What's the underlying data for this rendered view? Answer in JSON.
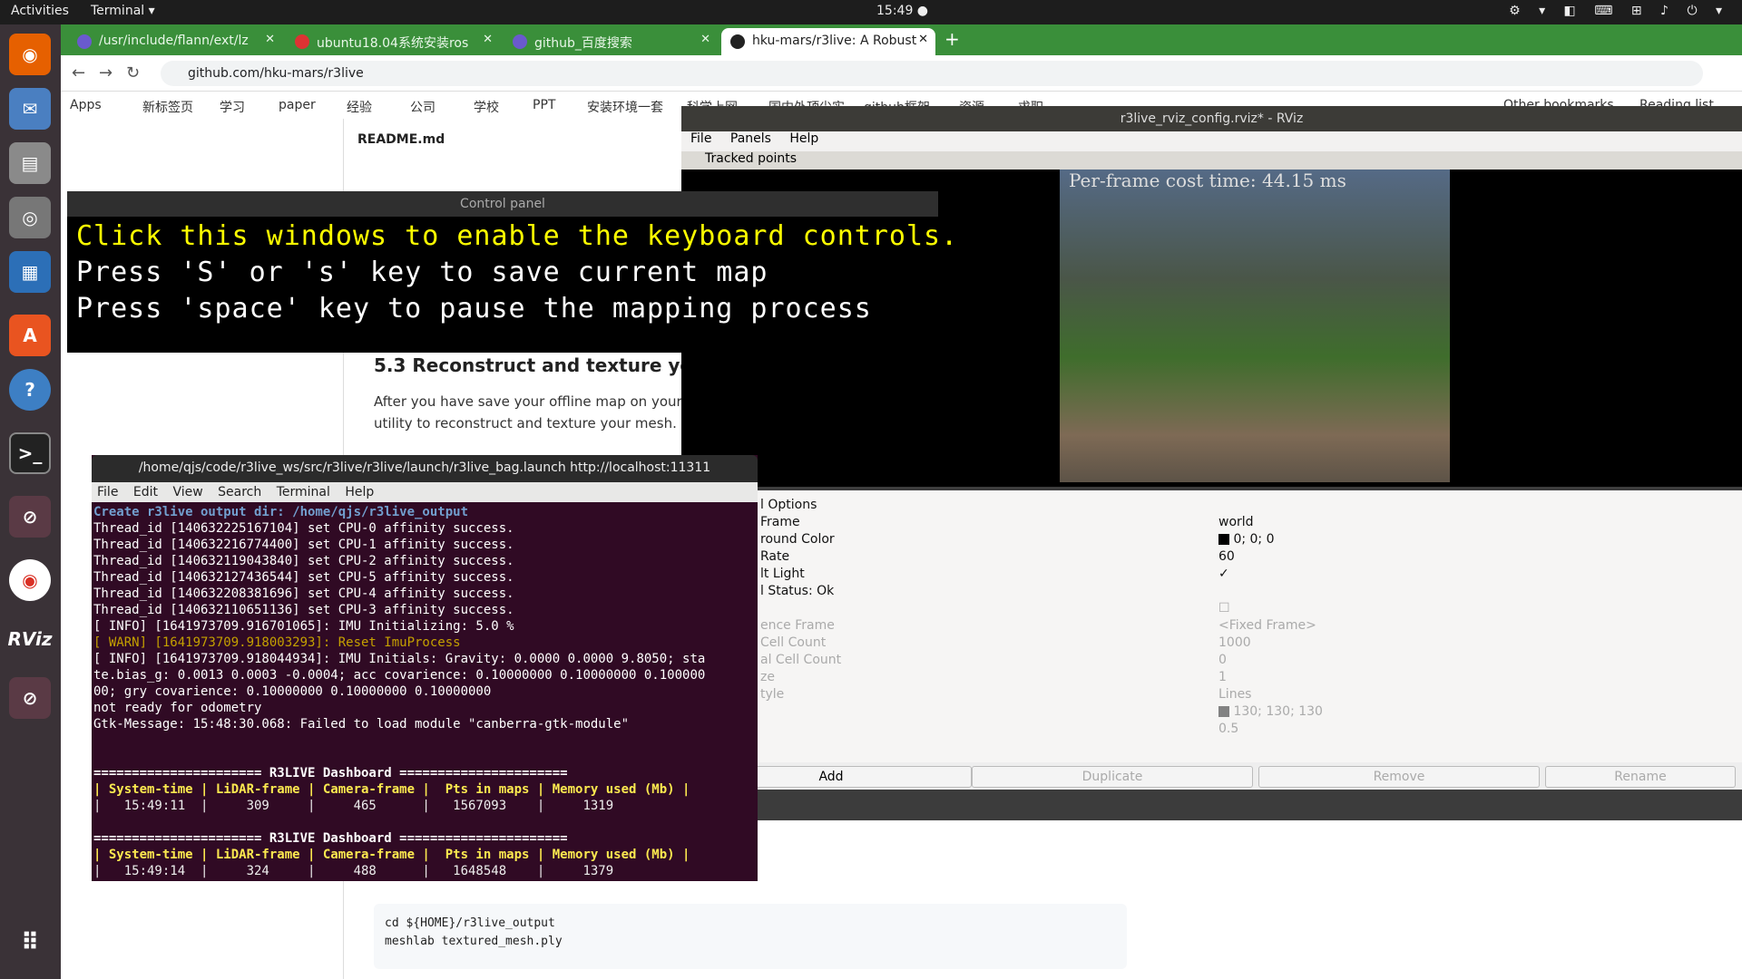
{
  "topbar": {
    "activities": "Activities",
    "app": "Terminal ▾",
    "clock": "15:49 ●"
  },
  "tabs": [
    {
      "title": "/usr/include/flann/ext/lz"
    },
    {
      "title": "ubuntu18.04系统安装ros"
    },
    {
      "title": "github_百度搜索"
    },
    {
      "title": "hku-mars/r3live: A Robust"
    }
  ],
  "url": "github.com/hku-mars/r3live",
  "bookmarks": [
    "Apps",
    "新标签页",
    "学习",
    "paper",
    "经验",
    "公司",
    "学校",
    "PPT",
    "安装环境一套",
    "科学上网",
    "国内外顶尖实",
    "github框架",
    "资源",
    "求职",
    "Other bookmarks",
    "Reading list"
  ],
  "page": {
    "readme": "README.md",
    "heading": "5.3 Reconstruct and texture your me",
    "para": "After you have save your offline map on your dis our utility to reconstruct and texture your mesh.",
    "code_lines": [
      "cd ${HOME}/r3live_output",
      "meshlab textured_mesh.ply"
    ]
  },
  "rviz": {
    "title": "r3live_rviz_config.rviz* - RViz",
    "menu": [
      "File",
      "Panels",
      "Help"
    ],
    "tracked": "Tracked points",
    "overlay": "Per-frame cost time: 44.15 ms",
    "props": [
      {
        "label": "l Options",
        "value": ""
      },
      {
        "label": "Frame",
        "value": "world"
      },
      {
        "label": "round Color",
        "value": "0; 0; 0"
      },
      {
        "label": "Rate",
        "value": "60"
      },
      {
        "label": "lt Light",
        "value": "✓"
      },
      {
        "label": "l Status: Ok",
        "value": ""
      },
      {
        "label": "",
        "value": "☐"
      },
      {
        "label": "ence Frame",
        "value": "<Fixed Frame>"
      },
      {
        "label": "Cell Count",
        "value": "1000"
      },
      {
        "label": "al Cell Count",
        "value": "0"
      },
      {
        "label": "ze",
        "value": "1"
      },
      {
        "label": "tyle",
        "value": "Lines"
      },
      {
        "label": "",
        "value": "130; 130; 130"
      },
      {
        "label": "",
        "value": "0.5"
      }
    ],
    "buttons": [
      "Add",
      "Duplicate",
      "Remove",
      "Rename"
    ]
  },
  "control": {
    "title": "Control panel",
    "line1": "Click this windows to enable the keyboard controls.",
    "line2": "Press 'S' or 's' key to save current map",
    "line3": "Press 'space' key to pause the mapping process"
  },
  "terminal": {
    "title": "/home/qjs/code/r3live_ws/src/r3live/r3live/launch/r3live_bag.launch http://localhost:11311",
    "menu": [
      "File",
      "Edit",
      "View",
      "Search",
      "Terminal",
      "Help"
    ],
    "lines": [
      {
        "t": "Create r3live output dir: /home/qjs/r3live_output",
        "c": "b"
      },
      {
        "t": "Thread_id [140632225167104] set CPU-0 affinity success.",
        "c": ""
      },
      {
        "t": "Thread_id [140632216774400] set CPU-1 affinity success.",
        "c": ""
      },
      {
        "t": "Thread_id [140632119043840] set CPU-2 affinity success.",
        "c": ""
      },
      {
        "t": "Thread_id [140632127436544] set CPU-5 affinity success.",
        "c": ""
      },
      {
        "t": "Thread_id [140632208381696] set CPU-4 affinity success.",
        "c": ""
      },
      {
        "t": "Thread_id [140632110651136] set CPU-3 affinity success.",
        "c": ""
      },
      {
        "t": "[ INFO] [1641973709.916701065]: IMU Initializing: 5.0 %",
        "c": ""
      },
      {
        "t": "[ WARN] [1641973709.918003293]: Reset ImuProcess",
        "c": "w"
      },
      {
        "t": "[ INFO] [1641973709.918044934]: IMU Initials: Gravity: 0.0000 0.0000 9.8050; sta",
        "c": ""
      },
      {
        "t": "te.bias_g: 0.0013 0.0003 -0.0004; acc covarience: 0.10000000 0.10000000 0.100000",
        "c": ""
      },
      {
        "t": "00; gry covarience: 0.10000000 0.10000000 0.10000000",
        "c": ""
      },
      {
        "t": "not ready for odometry",
        "c": ""
      },
      {
        "t": "Gtk-Message: 15:48:30.068: Failed to load module \"canberra-gtk-module\"",
        "c": ""
      },
      {
        "t": " ",
        "c": ""
      },
      {
        "t": " ",
        "c": ""
      },
      {
        "t": "====================== R3LIVE Dashboard ======================",
        "c": "bold"
      },
      {
        "t": "| System-time | LiDAR-frame | Camera-frame |  Pts in maps | Memory used (Mb) |",
        "c": "dash"
      },
      {
        "t": "|   15:49:11  |     309     |     465      |   1567093    |     1319",
        "c": "dashv"
      },
      {
        "t": " ",
        "c": ""
      },
      {
        "t": "====================== R3LIVE Dashboard ======================",
        "c": "bold"
      },
      {
        "t": "| System-time | LiDAR-frame | Camera-frame |  Pts in maps | Memory used (Mb) |",
        "c": "dash"
      },
      {
        "t": "|   15:49:14  |     324     |     488      |   1648548    |     1379",
        "c": "dashv"
      }
    ]
  },
  "colors": {
    "chrome_green": "#3a8f3a",
    "terminal_bg": "#300a24",
    "warn": "#c4a000",
    "info_blue": "#729fcf",
    "yellow_text": "#ffff00"
  }
}
